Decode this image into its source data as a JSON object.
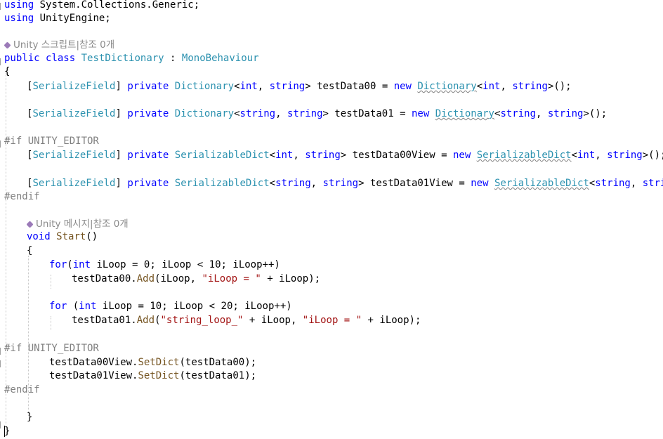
{
  "codelens": {
    "class": "Unity 스크립트|참조 0개",
    "method": "Unity 메시지|참조 0개"
  },
  "code": {
    "using1_kw": "using",
    "using1_ns": " System.Collections.Generic;",
    "using2_kw": "using",
    "using2_ns": " UnityEngine;",
    "class_public": "public",
    "class_kw": "class",
    "class_name": "TestDictionary",
    "class_colon": " : ",
    "class_base": "MonoBehaviour",
    "open_brace": "{",
    "close_brace": "}",
    "serialize_attr": "SerializeField",
    "private_kw": "private",
    "new_kw": "new",
    "dict_type": "Dictionary",
    "sdict_type": "SerializableDict",
    "int_kw": "int",
    "string_kw": "string",
    "var_data00": "testData00",
    "var_data01": "testData01",
    "var_view00": "testData00View",
    "var_view01": "testData01View",
    "if_editor": "#if UNITY_EDITOR",
    "endif": "#endif",
    "void_kw": "void",
    "start_method": "Start",
    "for_kw": "for",
    "iloop": "iLoop",
    "add_method": "Add",
    "setdict_method": "SetDict",
    "str_iloop": "\"iLoop = \"",
    "str_string_loop": "\"string_loop_\"",
    "num_0": "0",
    "num_10": "10",
    "num_20": "20"
  },
  "colors": {
    "keyword": "#0000ff",
    "type": "#2b91af",
    "method": "#74531f",
    "string": "#a31515",
    "preprocessor": "#808080",
    "codelens": "#8a8a8a"
  }
}
